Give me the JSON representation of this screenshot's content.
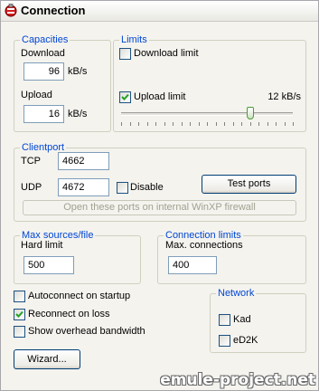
{
  "header": {
    "title": "Connection",
    "icon": "emule-app-icon"
  },
  "capacities": {
    "legend": "Capacities",
    "download_label": "Download",
    "download_value": "96",
    "download_unit": "kB/s",
    "upload_label": "Upload",
    "upload_value": "16",
    "upload_unit": "kB/s"
  },
  "limits": {
    "legend": "Limits",
    "download_limit_label": "Download limit",
    "download_limit_checked": false,
    "upload_limit_label": "Upload limit",
    "upload_limit_checked": true,
    "upload_limit_value": "12 kB/s",
    "upload_slider_fraction": 0.75
  },
  "clientport": {
    "legend": "Clientport",
    "tcp_label": "TCP",
    "tcp_value": "4662",
    "udp_label": "UDP",
    "udp_value": "4672",
    "disable_label": "Disable",
    "disable_checked": false,
    "test_ports_label": "Test ports",
    "firewall_button_label": "Open these ports on internal WinXP firewall"
  },
  "max_sources": {
    "legend": "Max sources/file",
    "hard_limit_label": "Hard limit",
    "hard_limit_value": "500"
  },
  "connection_limits": {
    "legend": "Connection limits",
    "max_connections_label": "Max. connections",
    "max_connections_value": "400"
  },
  "options": {
    "autoconnect_label": "Autoconnect on startup",
    "autoconnect_checked": false,
    "reconnect_label": "Reconnect on loss",
    "reconnect_checked": true,
    "overhead_label": "Show overhead bandwidth",
    "overhead_checked": false
  },
  "network": {
    "legend": "Network",
    "kad_label": "Kad",
    "kad_checked": false,
    "ed2k_label": "eD2K",
    "ed2k_checked": false
  },
  "wizard_label": "Wizard...",
  "watermark": "emule-project.net",
  "colors": {
    "legend_text": "#0046d5",
    "check_mark": "#21a121",
    "input_border": "#7f9db9",
    "button_border": "#003c74"
  }
}
